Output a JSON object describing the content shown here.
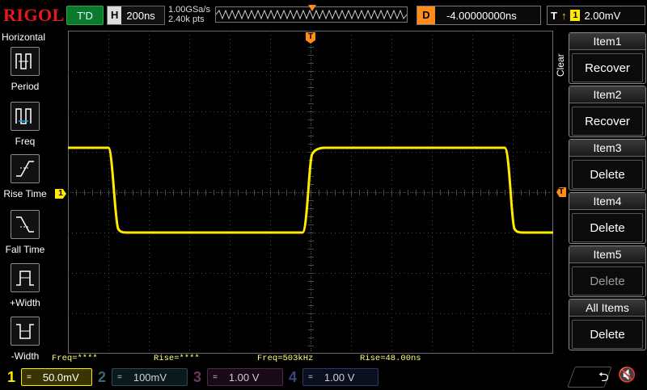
{
  "brand": "RIGOL",
  "top": {
    "run_status": "T'D",
    "timebase_tag": "H",
    "timebase_value": "200ns",
    "sample_rate": "1.00GSa/s",
    "memory_depth": "2.40k pts",
    "delay_tag": "D",
    "delay_value": "-4.00000000ns",
    "trigger_tag": "T",
    "trigger_source": "1",
    "trigger_level": "2.00mV"
  },
  "left_menu": {
    "title": "Horizontal",
    "items": [
      {
        "label": "Period",
        "icon": "period-icon"
      },
      {
        "label": "Freq",
        "icon": "frequency-icon"
      },
      {
        "label": "Rise Time",
        "icon": "rise-time-icon"
      },
      {
        "label": "Fall Time",
        "icon": "fall-time-icon"
      },
      {
        "label": "+Width",
        "icon": "positive-width-icon"
      },
      {
        "label": "-Width",
        "icon": "negative-width-icon"
      }
    ]
  },
  "right_menu": {
    "group_label": "Clear",
    "items": [
      {
        "title": "Item1",
        "action": "Recover",
        "enabled": true
      },
      {
        "title": "Item2",
        "action": "Recover",
        "enabled": true
      },
      {
        "title": "Item3",
        "action": "Delete",
        "enabled": true
      },
      {
        "title": "Item4",
        "action": "Delete",
        "enabled": true
      },
      {
        "title": "Item5",
        "action": "Delete",
        "enabled": false
      },
      {
        "title": "All Items",
        "action": "Delete",
        "enabled": true
      }
    ]
  },
  "measurements": [
    {
      "text": "Freq=****"
    },
    {
      "text": "Rise=****"
    },
    {
      "text": "Freq=503kHz"
    },
    {
      "text": "Rise=48.00ns"
    }
  ],
  "channels": [
    {
      "num": "1",
      "coupling": "=",
      "scale": "50.0mV",
      "color": "#ffea00",
      "active": true
    },
    {
      "num": "2",
      "coupling": "=",
      "scale": "100mV",
      "color": "#00d8e8",
      "active": false
    },
    {
      "num": "3",
      "coupling": "=",
      "scale": "1.00 V",
      "color": "#e040c0",
      "active": false
    },
    {
      "num": "4",
      "coupling": "=",
      "scale": "1.00 V",
      "color": "#2f6bff",
      "active": false
    }
  ],
  "markers": {
    "ch1_ground": "1",
    "trigger_level": "T"
  },
  "waveform": {
    "channel": "1",
    "color": "#ffea00",
    "shape": "square",
    "high_divisions": 1.1,
    "low_divisions": -1.0
  },
  "colors": {
    "grid": "#4a4a4a",
    "trigger": "#ff8c1a",
    "brand": "#e8181d"
  }
}
